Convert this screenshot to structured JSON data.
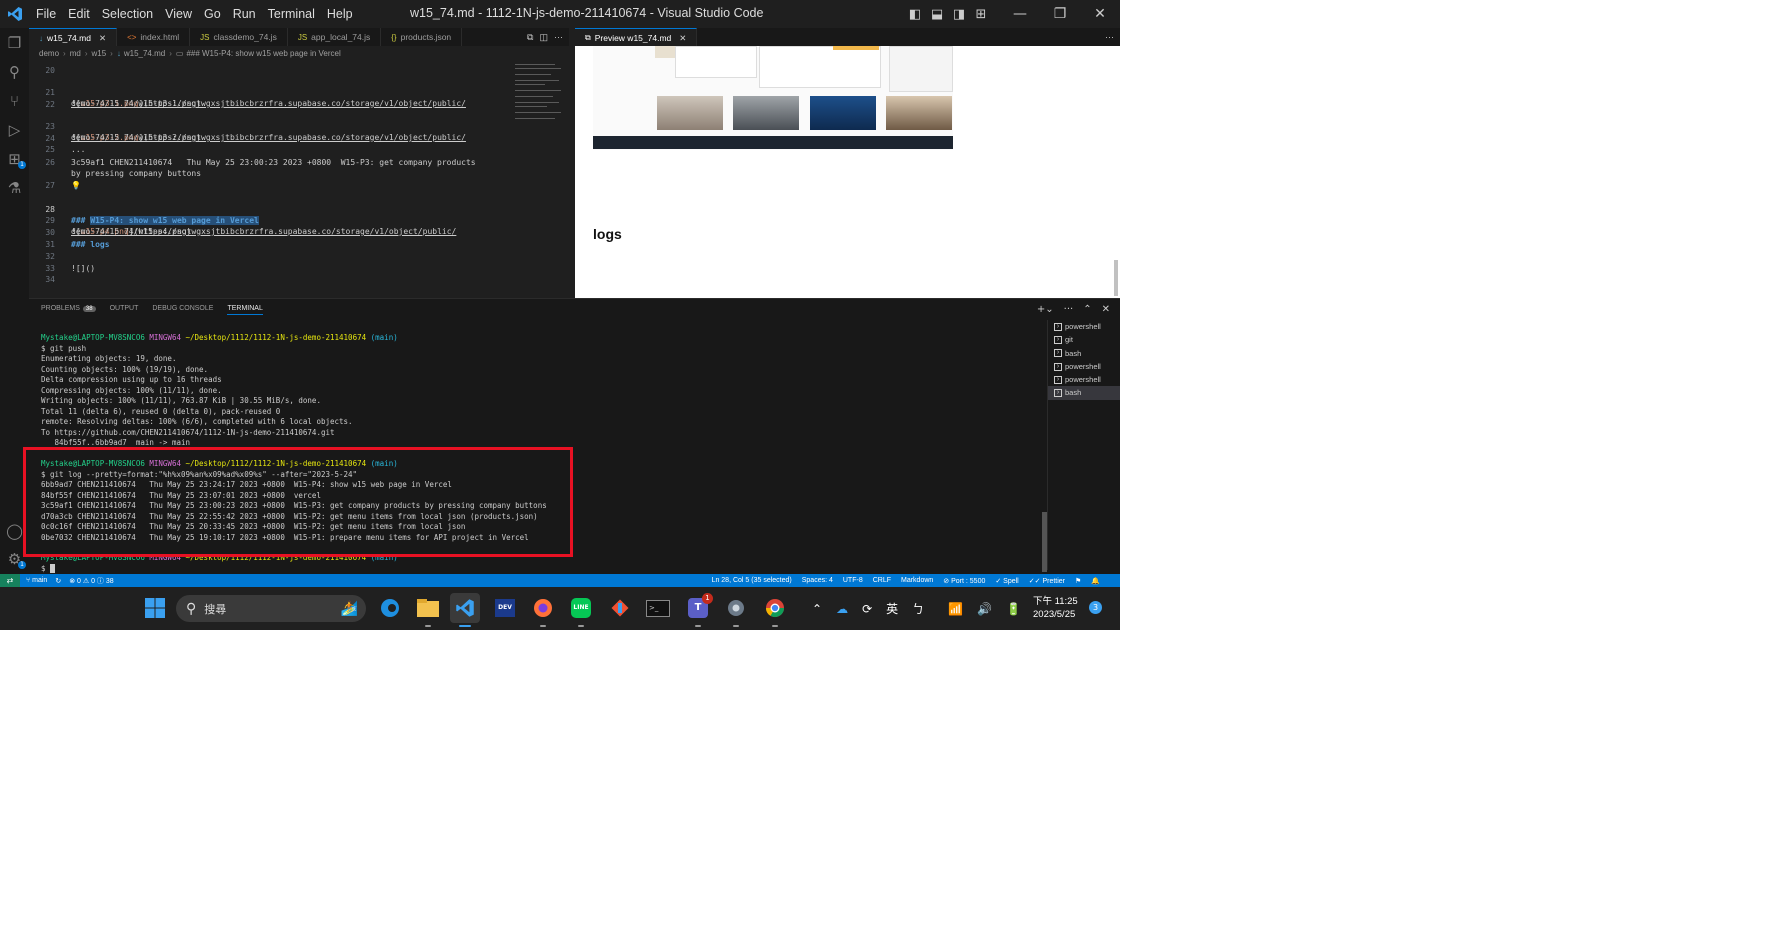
{
  "window": {
    "title": "w15_74.md - 1112-1N-js-demo-211410674 - Visual Studio Code",
    "menu": [
      "File",
      "Edit",
      "Selection",
      "View",
      "Go",
      "Run",
      "Terminal",
      "Help"
    ]
  },
  "colors": {
    "accent": "#0078d4",
    "highlight_box": "#e81123",
    "remote": "#16825d"
  },
  "activity_icons": [
    "explorer-icon",
    "search-icon",
    "source-control-icon",
    "run-debug-icon",
    "extensions-icon",
    "testing-icon"
  ],
  "activity_badge": "1",
  "editor_tabs": [
    {
      "label": "w15_74.md",
      "icon": "↓",
      "active": true
    },
    {
      "label": "index.html",
      "icon": "<>",
      "active": false
    },
    {
      "label": "classdemo_74.js",
      "icon": "JS",
      "active": false
    },
    {
      "label": "app_local_74.js",
      "icon": "JS",
      "active": false
    },
    {
      "label": "products.json",
      "icon": "{}",
      "active": false
    }
  ],
  "breadcrumb": [
    "demo",
    "md",
    "w15",
    "w15_74.md",
    "### W15-P4: show w15 web page in Vercel"
  ],
  "code": [
    {
      "n": "20",
      "text": ""
    },
    {
      "n": "21",
      "alt": "w15-p3-1.png",
      "url": "https://sgtwgxsjtbibcbrzrfra.supabase.co/storage/v1/object/public/",
      "url2": "demo-74/15_74/w15-p3-1.png"
    },
    {
      "n": "22",
      "text": ""
    },
    {
      "n": "23",
      "alt": "w15-p3-2.png",
      "url": "https://sgtwgxsjtbibcbrzrfra.supabase.co/storage/v1/object/public/",
      "url2": "demo-74/15_74/w15-p3-2.png"
    },
    {
      "n": "24",
      "text": ""
    },
    {
      "n": "25",
      "text": "..."
    },
    {
      "n": "26",
      "text": "3c59af1 CHEN211410674   Thu May 25 23:00:23 2023 +0800  W15-P3: get company products",
      "text2": "by pressing company buttons"
    },
    {
      "n": "27",
      "text": ""
    },
    {
      "n": "28",
      "prefix": "### ",
      "sel": "W15-P4: show w15 web page in Vercel"
    },
    {
      "n": "29",
      "alt": "w15-p4.png",
      "url": "https://sgtwgxsjtbibcbrzrfra.supabase.co/storage/v1/object/public/",
      "url2": "demo-74/15_74/w15-p4.png"
    },
    {
      "n": "30",
      "text": ""
    },
    {
      "n": "31",
      "heading": "### logs"
    },
    {
      "n": "32",
      "text": ""
    },
    {
      "n": "33",
      "text": "![]()"
    },
    {
      "n": "34",
      "text": ""
    }
  ],
  "preview": {
    "tab": "Preview w15_74.md",
    "heading": "logs"
  },
  "panel": {
    "tabs": [
      "PROBLEMS",
      "OUTPUT",
      "DEBUG CONSOLE",
      "TERMINAL"
    ],
    "problems_count": "38"
  },
  "terminal": {
    "prompt_user": "Mystake@LAPTOP-MV8SNCO6",
    "prompt_env": "MINGW64",
    "prompt_path": "~/Desktop/1112/1112-1N-js-demo-211410674",
    "prompt_branch": "(main)",
    "push_cmd": "$ git push",
    "push_output": [
      "Enumerating objects: 19, done.",
      "Counting objects: 100% (19/19), done.",
      "Delta compression using up to 16 threads",
      "Compressing objects: 100% (11/11), done.",
      "Writing objects: 100% (11/11), 763.87 KiB | 30.55 MiB/s, done.",
      "Total 11 (delta 6), reused 0 (delta 0), pack-reused 0",
      "remote: Resolving deltas: 100% (6/6), completed with 6 local objects.",
      "To https://github.com/CHEN211410674/1112-1N-js-demo-211410674.git",
      "   84bf55f..6bb9ad7  main -> main"
    ],
    "log_cmd": "$ git log --pretty=format:\"%h%x09%an%x09%ad%x09%s\" --after=\"2023-5-24\"",
    "log_output": [
      "6bb9ad7 CHEN211410674   Thu May 25 23:24:17 2023 +0800  W15-P4: show w15 web page in Vercel",
      "84bf55f CHEN211410674   Thu May 25 23:07:01 2023 +0800  vercel",
      "3c59af1 CHEN211410674   Thu May 25 23:00:23 2023 +0800  W15-P3: get company products by pressing company buttons",
      "d70a3cb CHEN211410674   Thu May 25 22:55:42 2023 +0800  W15-P2: get menu items from local json (products.json)",
      "0c0c16f CHEN211410674   Thu May 25 20:33:45 2023 +0800  W15-P2: get menu items from local json",
      "0be7032 CHEN211410674   Thu May 25 19:10:17 2023 +0800  W15-P1: prepare menu items for API project in Vercel"
    ],
    "last_prompt": "$ "
  },
  "terminal_list": [
    {
      "label": "powershell",
      "active": false
    },
    {
      "label": "git",
      "active": false
    },
    {
      "label": "bash",
      "active": false
    },
    {
      "label": "powershell",
      "active": false
    },
    {
      "label": "powershell",
      "active": false
    },
    {
      "label": "bash",
      "active": true
    }
  ],
  "statusbar": {
    "branch": "main",
    "errors": "⊗ 0 ⚠ 0 ⓘ 38",
    "cursor": "Ln 28, Col 5 (35 selected)",
    "spaces": "Spaces: 4",
    "encoding": "UTF-8",
    "eol": "CRLF",
    "language": "Markdown",
    "port": "Port : 5500",
    "spell": "Spell",
    "prettier": "Prettier"
  },
  "taskbar": {
    "search_placeholder": "搜尋",
    "ime": "英",
    "time": "下午 11:25",
    "date": "2023/5/25",
    "notification_count": "3",
    "teams_badge": "1"
  }
}
